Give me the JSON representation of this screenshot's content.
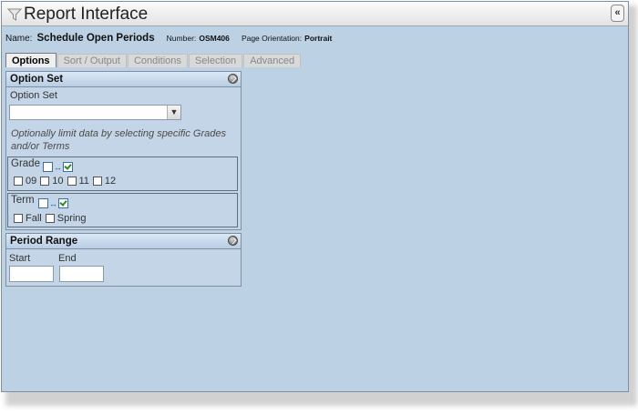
{
  "window": {
    "title": "Report Interface",
    "collapse_label": "«"
  },
  "info": {
    "name_label": "Name:",
    "name_value": "Schedule Open Periods",
    "number_label": "Number:",
    "number_value": "OSM406",
    "orientation_label": "Page Orientation:",
    "orientation_value": "Portrait"
  },
  "tabs": [
    {
      "label": "Options",
      "active": true
    },
    {
      "label": "Sort / Output",
      "active": false
    },
    {
      "label": "Conditions",
      "active": false
    },
    {
      "label": "Selection",
      "active": false
    },
    {
      "label": "Advanced",
      "active": false
    }
  ],
  "option_set_panel": {
    "title": "Option Set",
    "field_label": "Option Set",
    "select_value": "",
    "hint": "Optionally limit data by selecting specific Grades and/or Terms",
    "grade_group": {
      "title": "Grade",
      "options": [
        "09",
        "10",
        "11",
        "12"
      ]
    },
    "term_group": {
      "title": "Term",
      "options": [
        "Fall",
        "Spring"
      ]
    }
  },
  "period_range_panel": {
    "title": "Period Range",
    "start_label": "Start",
    "end_label": "End",
    "start_value": "",
    "end_value": ""
  },
  "icons": {
    "title_icon": "funnel-icon",
    "panel_toggle": "collapse-circle-icon",
    "select_all": "select-all-icon",
    "swap": "swap-arrows-icon",
    "check_all": "check-all-icon"
  }
}
